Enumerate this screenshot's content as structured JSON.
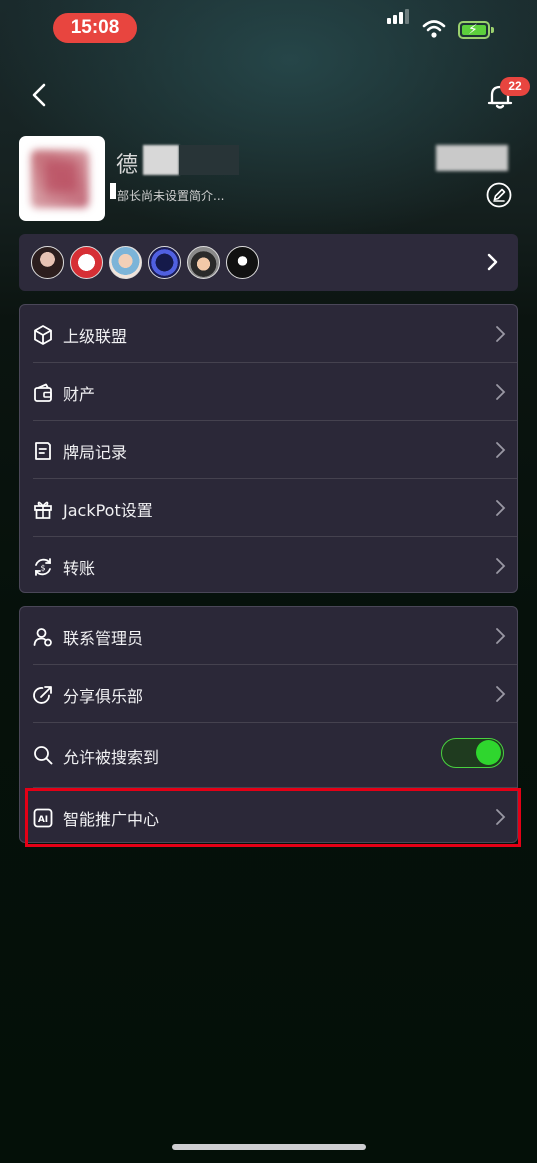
{
  "status_bar": {
    "time": "15:08"
  },
  "header": {
    "notification_count": "22"
  },
  "profile": {
    "name_visible_char": "德",
    "bio": "部长尚未设置简介..."
  },
  "menu_group_1": [
    {
      "label": "上级联盟",
      "icon": "cube-icon"
    },
    {
      "label": "财产",
      "icon": "wallet-icon"
    },
    {
      "label": "牌局记录",
      "icon": "record-icon"
    },
    {
      "label": "JackPot设置",
      "icon": "gift-icon"
    },
    {
      "label": "转账",
      "icon": "transfer-icon"
    }
  ],
  "menu_group_2": [
    {
      "label": "联系管理员",
      "icon": "admin-icon"
    },
    {
      "label": "分享俱乐部",
      "icon": "share-icon"
    },
    {
      "label": "允许被搜索到",
      "icon": "search-icon",
      "toggle": true
    },
    {
      "label": "智能推广中心",
      "icon": "ai-icon"
    }
  ],
  "colors": {
    "accent_red": "#e8453f",
    "toggle_green": "#2fd62e",
    "card_bg": "#2b2838",
    "highlight": "#e40016"
  }
}
